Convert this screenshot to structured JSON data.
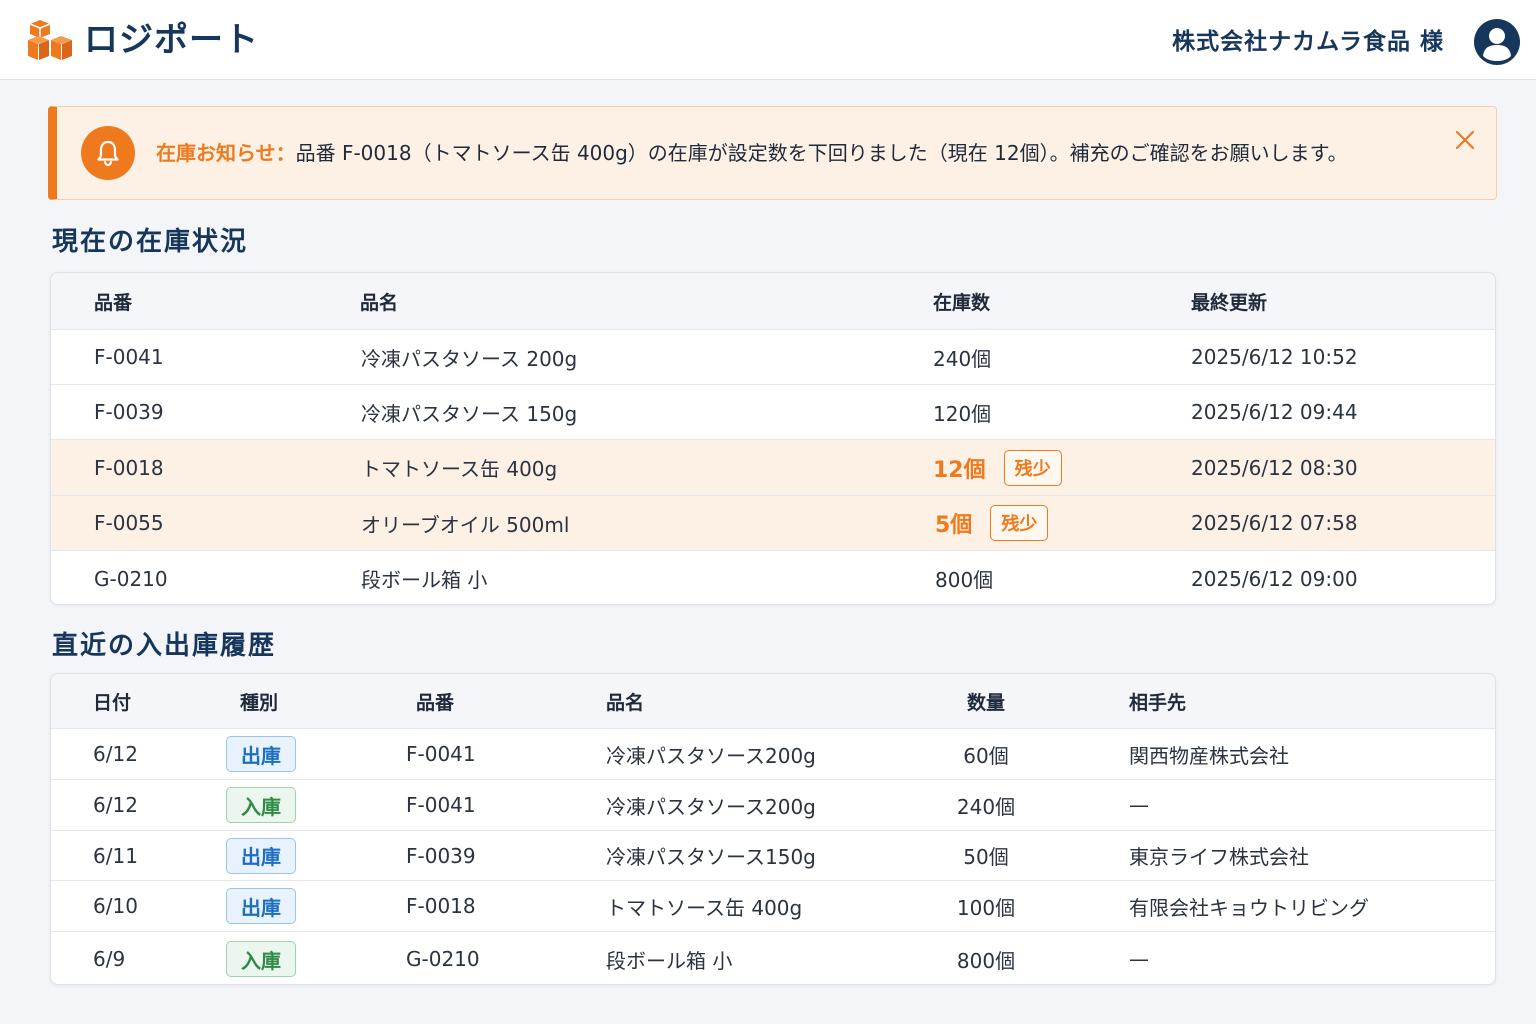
{
  "header": {
    "app_name": "ロジポート",
    "company_name": "株式会社ナカムラ食品 様"
  },
  "alert": {
    "title": "在庫お知らせ：",
    "message": "品番 F-0018（トマトソース缶 400g）の在庫が設定数を下回りました（現在 12個）。補充のご確認をお願いします。"
  },
  "inventory": {
    "title": "現在の在庫状況",
    "columns": [
      "品番",
      "品名",
      "在庫数",
      "最終更新"
    ],
    "badge_low": "残少",
    "rows": [
      {
        "code": "F-0041",
        "name": "冷凍パスタソース 200g",
        "qty": "240個",
        "updated": "2025/6/12 10:52",
        "low": false
      },
      {
        "code": "F-0039",
        "name": "冷凍パスタソース 150g",
        "qty": "120個",
        "updated": "2025/6/12 09:44",
        "low": false
      },
      {
        "code": "F-0018",
        "name": "トマトソース缶 400g",
        "qty": "12個",
        "updated": "2025/6/12 08:30",
        "low": true
      },
      {
        "code": "F-0055",
        "name": "オリーブオイル 500ml",
        "qty": "5個",
        "updated": "2025/6/12 07:58",
        "low": true
      },
      {
        "code": "G-0210",
        "name": "段ボール箱 小",
        "qty": "800個",
        "updated": "2025/6/12 09:00",
        "low": false
      }
    ]
  },
  "history": {
    "title": "直近の入出庫履歴",
    "columns": [
      "日付",
      "種別",
      "品番",
      "品名",
      "数量",
      "相手先"
    ],
    "rows": [
      {
        "date": "6/12",
        "type": "出庫",
        "kind": "out",
        "code": "F-0041",
        "name": "冷凍パスタソース200g",
        "qty": "60個",
        "partner": "関西物産株式会社"
      },
      {
        "date": "6/12",
        "type": "入庫",
        "kind": "in",
        "code": "F-0041",
        "name": "冷凍パスタソース200g",
        "qty": "240個",
        "partner": "—"
      },
      {
        "date": "6/11",
        "type": "出庫",
        "kind": "out",
        "code": "F-0039",
        "name": "冷凍パスタソース150g",
        "qty": "50個",
        "partner": "東京ライフ株式会社"
      },
      {
        "date": "6/10",
        "type": "出庫",
        "kind": "out",
        "code": "F-0018",
        "name": "トマトソース缶 400g",
        "qty": "100個",
        "partner": "有限会社キョウトリビング"
      },
      {
        "date": "6/9",
        "type": "入庫",
        "kind": "in",
        "code": "G-0210",
        "name": "段ボール箱 小",
        "qty": "800個",
        "partner": "—"
      }
    ]
  },
  "colors": {
    "brand_navy": "#17365c",
    "accent_orange": "#ef7a1e",
    "out_blue": "#1f6fc0",
    "in_green": "#2e8b45"
  },
  "icons": {
    "logo": "boxes-logo-icon",
    "avatar": "user-avatar-icon",
    "bell": "bell-icon",
    "close": "close-icon"
  }
}
